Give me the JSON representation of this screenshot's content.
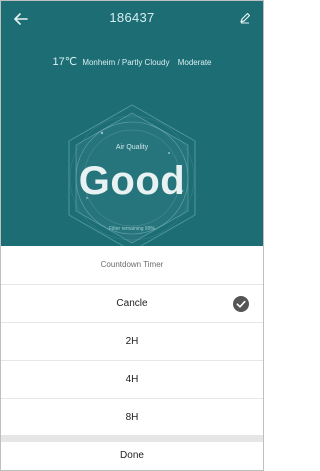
{
  "header": {
    "title": "186437",
    "back_icon": "arrow-left-icon",
    "edit_icon": "pencil-icon"
  },
  "weather": {
    "temperature": "17℃",
    "location": "Monheim / Partly Cloudy",
    "aqi_level": "Moderate"
  },
  "air_quality": {
    "label": "Air Quality",
    "value": "Good",
    "filter_text": "Filter remaining 99%"
  },
  "sheet": {
    "title": "Countdown Timer",
    "options": [
      "Cancle",
      "2H",
      "4H",
      "8H"
    ],
    "selected_index": 0,
    "done_label": "Done"
  },
  "colors": {
    "background": "#1c6d74",
    "check": "#555555"
  }
}
